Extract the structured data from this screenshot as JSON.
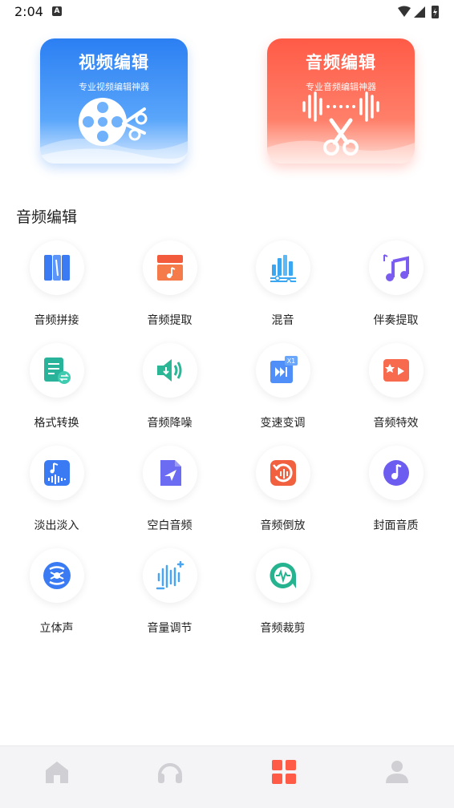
{
  "status_bar": {
    "time": "2:04",
    "indicator": "A"
  },
  "cards": {
    "video": {
      "title": "视频编辑",
      "subtitle": "专业视频编辑神器"
    },
    "audio": {
      "title": "音频编辑",
      "subtitle": "专业音频编辑神器"
    }
  },
  "section": {
    "title": "音频编辑"
  },
  "tools": [
    {
      "label": "音频拼接",
      "icon": "audio-merge-icon"
    },
    {
      "label": "音频提取",
      "icon": "audio-extract-icon"
    },
    {
      "label": "混音",
      "icon": "mixer-icon"
    },
    {
      "label": "伴奏提取",
      "icon": "accompaniment-icon"
    },
    {
      "label": "格式转换",
      "icon": "format-convert-icon"
    },
    {
      "label": "音频降噪",
      "icon": "noise-reduction-icon"
    },
    {
      "label": "变速变调",
      "icon": "speed-pitch-icon"
    },
    {
      "label": "音频特效",
      "icon": "audio-effects-icon"
    },
    {
      "label": "淡出淡入",
      "icon": "fade-icon"
    },
    {
      "label": "空白音频",
      "icon": "blank-audio-icon"
    },
    {
      "label": "音频倒放",
      "icon": "reverse-icon"
    },
    {
      "label": "封面音质",
      "icon": "cover-quality-icon"
    },
    {
      "label": "立体声",
      "icon": "stereo-icon"
    },
    {
      "label": "音量调节",
      "icon": "volume-adjust-icon"
    },
    {
      "label": "音频裁剪",
      "icon": "audio-trim-icon"
    }
  ],
  "tab_bar": {
    "tabs": [
      {
        "name": "home",
        "icon": "home-icon",
        "active": false
      },
      {
        "name": "audio",
        "icon": "headphones-icon",
        "active": false
      },
      {
        "name": "tools",
        "icon": "grid-icon",
        "active": true
      },
      {
        "name": "profile",
        "icon": "user-icon",
        "active": false
      }
    ],
    "active_color": "#ff5b47",
    "inactive_color": "#cfcfd4"
  }
}
